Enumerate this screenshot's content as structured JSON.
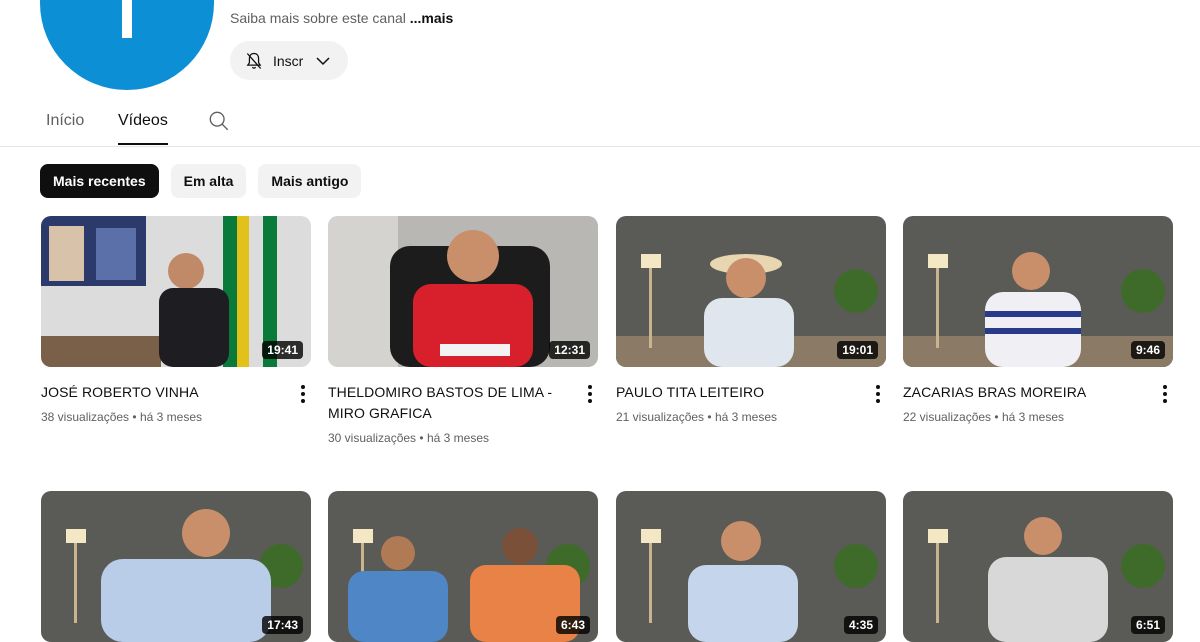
{
  "channel": {
    "about_text": "Saiba mais sobre este canal",
    "more_label": "...mais",
    "subscribe_label": "Inscr",
    "avatar_color": "#0d8fd6"
  },
  "tabs": [
    {
      "label": "Início",
      "active": false
    },
    {
      "label": "Vídeos",
      "active": true
    }
  ],
  "chips": [
    {
      "label": "Mais recentes",
      "selected": true
    },
    {
      "label": "Em alta",
      "selected": false
    },
    {
      "label": "Mais antigo",
      "selected": false
    }
  ],
  "videos": [
    {
      "title": "JOSÉ ROBERTO VINHA",
      "views": "38 visualizações",
      "age": "há 3 meses",
      "duration": "19:41"
    },
    {
      "title": "THELDOMIRO BASTOS DE LIMA - MIRO GRAFICA",
      "views": "30 visualizações",
      "age": "há 3 meses",
      "duration": "12:31"
    },
    {
      "title": "PAULO TITA LEITEIRO",
      "views": "21 visualizações",
      "age": "há 3 meses",
      "duration": "19:01"
    },
    {
      "title": "ZACARIAS BRAS MOREIRA",
      "views": "22 visualizações",
      "age": "há 3 meses",
      "duration": "9:46"
    },
    {
      "title": "",
      "views": "",
      "age": "",
      "duration": "17:43"
    },
    {
      "title": "",
      "views": "",
      "age": "",
      "duration": "6:43"
    },
    {
      "title": "",
      "views": "",
      "age": "",
      "duration": "4:35"
    },
    {
      "title": "",
      "views": "",
      "age": "",
      "duration": "6:51"
    }
  ]
}
